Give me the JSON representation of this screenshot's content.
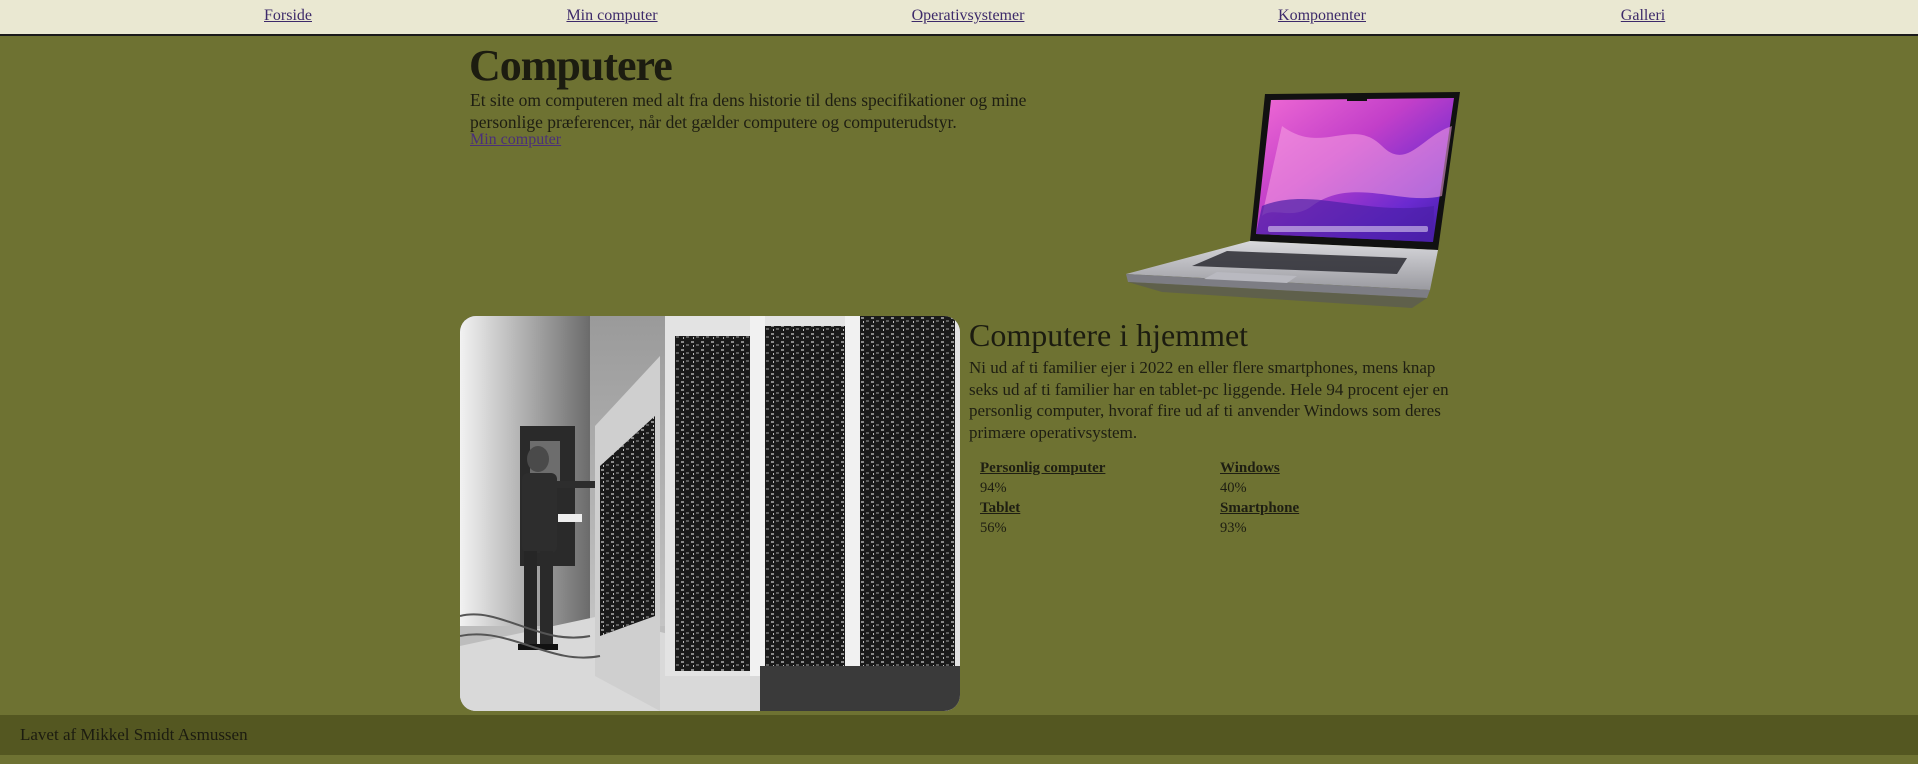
{
  "nav": {
    "items": [
      {
        "label": "Forside"
      },
      {
        "label": "Min computer"
      },
      {
        "label": "Operativsystemer"
      },
      {
        "label": "Komponenter"
      },
      {
        "label": "Galleri"
      }
    ]
  },
  "hero": {
    "title": "Computere",
    "text": "Et site om computeren med alt fra dens historie til dens specifikationer og mine personlige præferencer, når det gælder computere og computerudstyr.",
    "link": "Min computer"
  },
  "home_section": {
    "title": "Computere i hjemmet",
    "text": "Ni ud af ti familier ejer i 2022 en eller flere smartphones, mens knap seks ud af ti familier har en tablet-pc liggende. Hele 94 procent ejer en personlig computer, hvoraf fire ud af ti anvender Windows som deres primære operativsystem.",
    "stats": [
      {
        "label": "Personlig computer",
        "value": "94%"
      },
      {
        "label": "Windows",
        "value": "40%"
      },
      {
        "label": "Tablet",
        "value": "56%"
      },
      {
        "label": "Smartphone",
        "value": "93%"
      }
    ]
  },
  "footer": {
    "text": "Lavet af Mikkel Smidt Asmussen"
  },
  "colors": {
    "background": "#6e7232",
    "nav_background": "#eae8d2",
    "footer_background": "#545721",
    "link": "#3d2a6a"
  }
}
